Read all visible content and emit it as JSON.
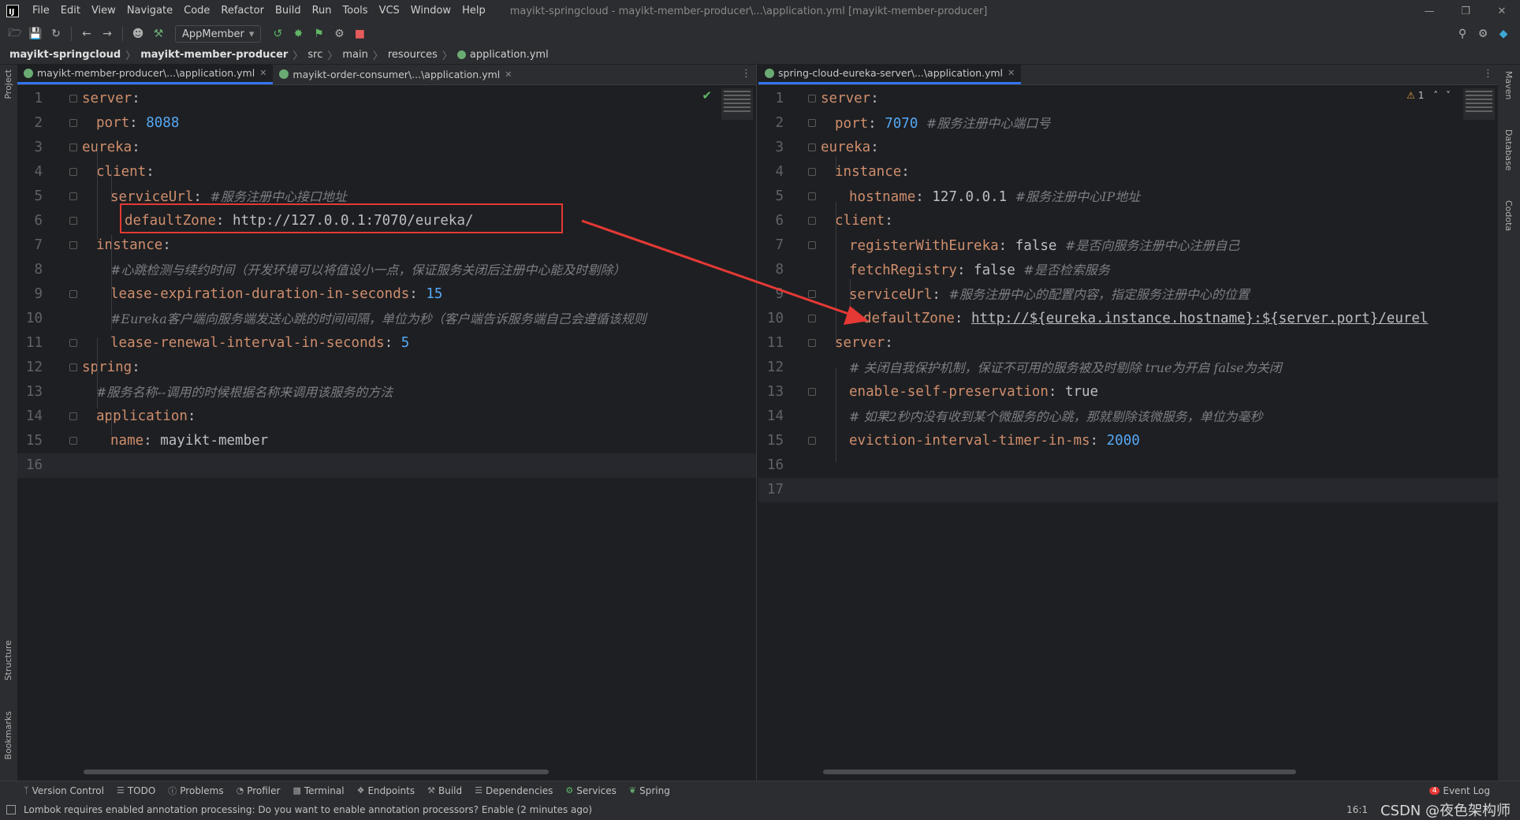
{
  "window": {
    "title": "mayikt-springcloud - mayikt-member-producer\\...\\application.yml [mayikt-member-producer]",
    "menu": [
      "File",
      "Edit",
      "View",
      "Navigate",
      "Code",
      "Refactor",
      "Build",
      "Run",
      "Tools",
      "VCS",
      "Window",
      "Help"
    ]
  },
  "toolbar": {
    "run_config": "AppMember"
  },
  "breadcrumb": [
    "mayikt-springcloud",
    "mayikt-member-producer",
    "src",
    "main",
    "resources",
    "application.yml"
  ],
  "side_tabs": {
    "left_top": "Project",
    "left_structure": "Structure",
    "left_bookmarks": "Bookmarks",
    "right_maven": "Maven",
    "right_database": "Database",
    "right_codota": "Codota"
  },
  "left_editor": {
    "tabs": [
      "mayikt-member-producer\\...\\application.yml",
      "mayikt-order-consumer\\...\\application.yml"
    ],
    "lines": [
      {
        "n": "1",
        "indent": 0,
        "key": "server",
        "val": "",
        "cmt": ""
      },
      {
        "n": "2",
        "indent": 1,
        "key": "port",
        "val": "8088",
        "cmt": ""
      },
      {
        "n": "3",
        "indent": 0,
        "key": "eureka",
        "val": "",
        "cmt": ""
      },
      {
        "n": "4",
        "indent": 1,
        "key": "client",
        "val": "",
        "cmt": ""
      },
      {
        "n": "5",
        "indent": 2,
        "key": "serviceUrl",
        "val": "",
        "cmt": "#服务注册中心接口地址"
      },
      {
        "n": "6",
        "indent": 3,
        "key": "defaultZone",
        "val": "http://127.0.0.1:7070/eureka/",
        "cmt": ""
      },
      {
        "n": "7",
        "indent": 1,
        "key": "instance",
        "val": "",
        "cmt": ""
      },
      {
        "n": "8",
        "indent": 2,
        "key": "",
        "val": "",
        "cmt": "#心跳检测与续约时间（开发环境可以将值设小一点，保证服务关闭后注册中心能及时剔除）"
      },
      {
        "n": "9",
        "indent": 2,
        "key": "lease-expiration-duration-in-seconds",
        "val": "15",
        "cmt": ""
      },
      {
        "n": "10",
        "indent": 2,
        "key": "",
        "val": "",
        "cmt": "#Eureka客户端向服务端发送心跳的时间间隔，单位为秒（客户端告诉服务端自己会遵循该规则"
      },
      {
        "n": "11",
        "indent": 2,
        "key": "lease-renewal-interval-in-seconds",
        "val": "5",
        "cmt": ""
      },
      {
        "n": "12",
        "indent": 0,
        "key": "spring",
        "val": "",
        "cmt": ""
      },
      {
        "n": "13",
        "indent": 1,
        "key": "",
        "val": "",
        "cmt": "#服务名称--调用的时候根据名称来调用该服务的方法"
      },
      {
        "n": "14",
        "indent": 1,
        "key": "application",
        "val": "",
        "cmt": ""
      },
      {
        "n": "15",
        "indent": 2,
        "key": "name",
        "val": "mayikt-member",
        "cmt": ""
      },
      {
        "n": "16",
        "indent": 0,
        "key": "",
        "val": "",
        "cmt": ""
      }
    ]
  },
  "right_editor": {
    "tabs": [
      "spring-cloud-eureka-server\\...\\application.yml"
    ],
    "warning_count": "1",
    "lines": [
      {
        "n": "1",
        "indent": 0,
        "key": "server",
        "val": "",
        "cmt": ""
      },
      {
        "n": "2",
        "indent": 1,
        "key": "port",
        "val": "7070",
        "cmt": "#服务注册中心端口号"
      },
      {
        "n": "3",
        "indent": 0,
        "key": "eureka",
        "val": "",
        "cmt": ""
      },
      {
        "n": "4",
        "indent": 1,
        "key": "instance",
        "val": "",
        "cmt": ""
      },
      {
        "n": "5",
        "indent": 2,
        "key": "hostname",
        "val": "127.0.0.1",
        "cmt": "#服务注册中心IP地址"
      },
      {
        "n": "6",
        "indent": 1,
        "key": "client",
        "val": "",
        "cmt": ""
      },
      {
        "n": "7",
        "indent": 2,
        "key": "registerWithEureka",
        "val": "false",
        "cmt": "#是否向服务注册中心注册自己"
      },
      {
        "n": "8",
        "indent": 2,
        "key": "fetchRegistry",
        "val": "false",
        "cmt": "#是否检索服务"
      },
      {
        "n": "9",
        "indent": 2,
        "key": "serviceUrl",
        "val": "",
        "cmt": "#服务注册中心的配置内容，指定服务注册中心的位置"
      },
      {
        "n": "10",
        "indent": 3,
        "key": "defaultZone",
        "val": "http://${eureka.instance.hostname}:${server.port}/eurel",
        "cmt": ""
      },
      {
        "n": "11",
        "indent": 1,
        "key": "server",
        "val": "",
        "cmt": ""
      },
      {
        "n": "12",
        "indent": 2,
        "key": "",
        "val": "",
        "cmt": "# 关闭自我保护机制，保证不可用的服务被及时剔除 true为开启 false为关闭"
      },
      {
        "n": "13",
        "indent": 2,
        "key": "enable-self-preservation",
        "val": "true",
        "cmt": ""
      },
      {
        "n": "14",
        "indent": 2,
        "key": "",
        "val": "",
        "cmt": "# 如果2秒内没有收到某个微服务的心跳，那就剔除该微服务，单位为毫秒"
      },
      {
        "n": "15",
        "indent": 2,
        "key": "eviction-interval-timer-in-ms",
        "val": "2000",
        "cmt": ""
      },
      {
        "n": "16",
        "indent": 0,
        "key": "",
        "val": "",
        "cmt": ""
      },
      {
        "n": "17",
        "indent": 0,
        "key": "",
        "val": "",
        "cmt": ""
      }
    ]
  },
  "bottom_tools": [
    "Version Control",
    "TODO",
    "Problems",
    "Profiler",
    "Terminal",
    "Endpoints",
    "Build",
    "Dependencies",
    "Services",
    "Spring"
  ],
  "event_log": {
    "label": "Event Log",
    "count": "4"
  },
  "status": {
    "message": "Lombok requires enabled annotation processing: Do you want to enable annotation processors? Enable (2 minutes ago)",
    "position": "16:1",
    "watermark": "CSDN @夜色架构师"
  },
  "colors": {
    "accent": "#3574f0",
    "highlight_box": "#e53935",
    "arrow": "#e53935"
  }
}
